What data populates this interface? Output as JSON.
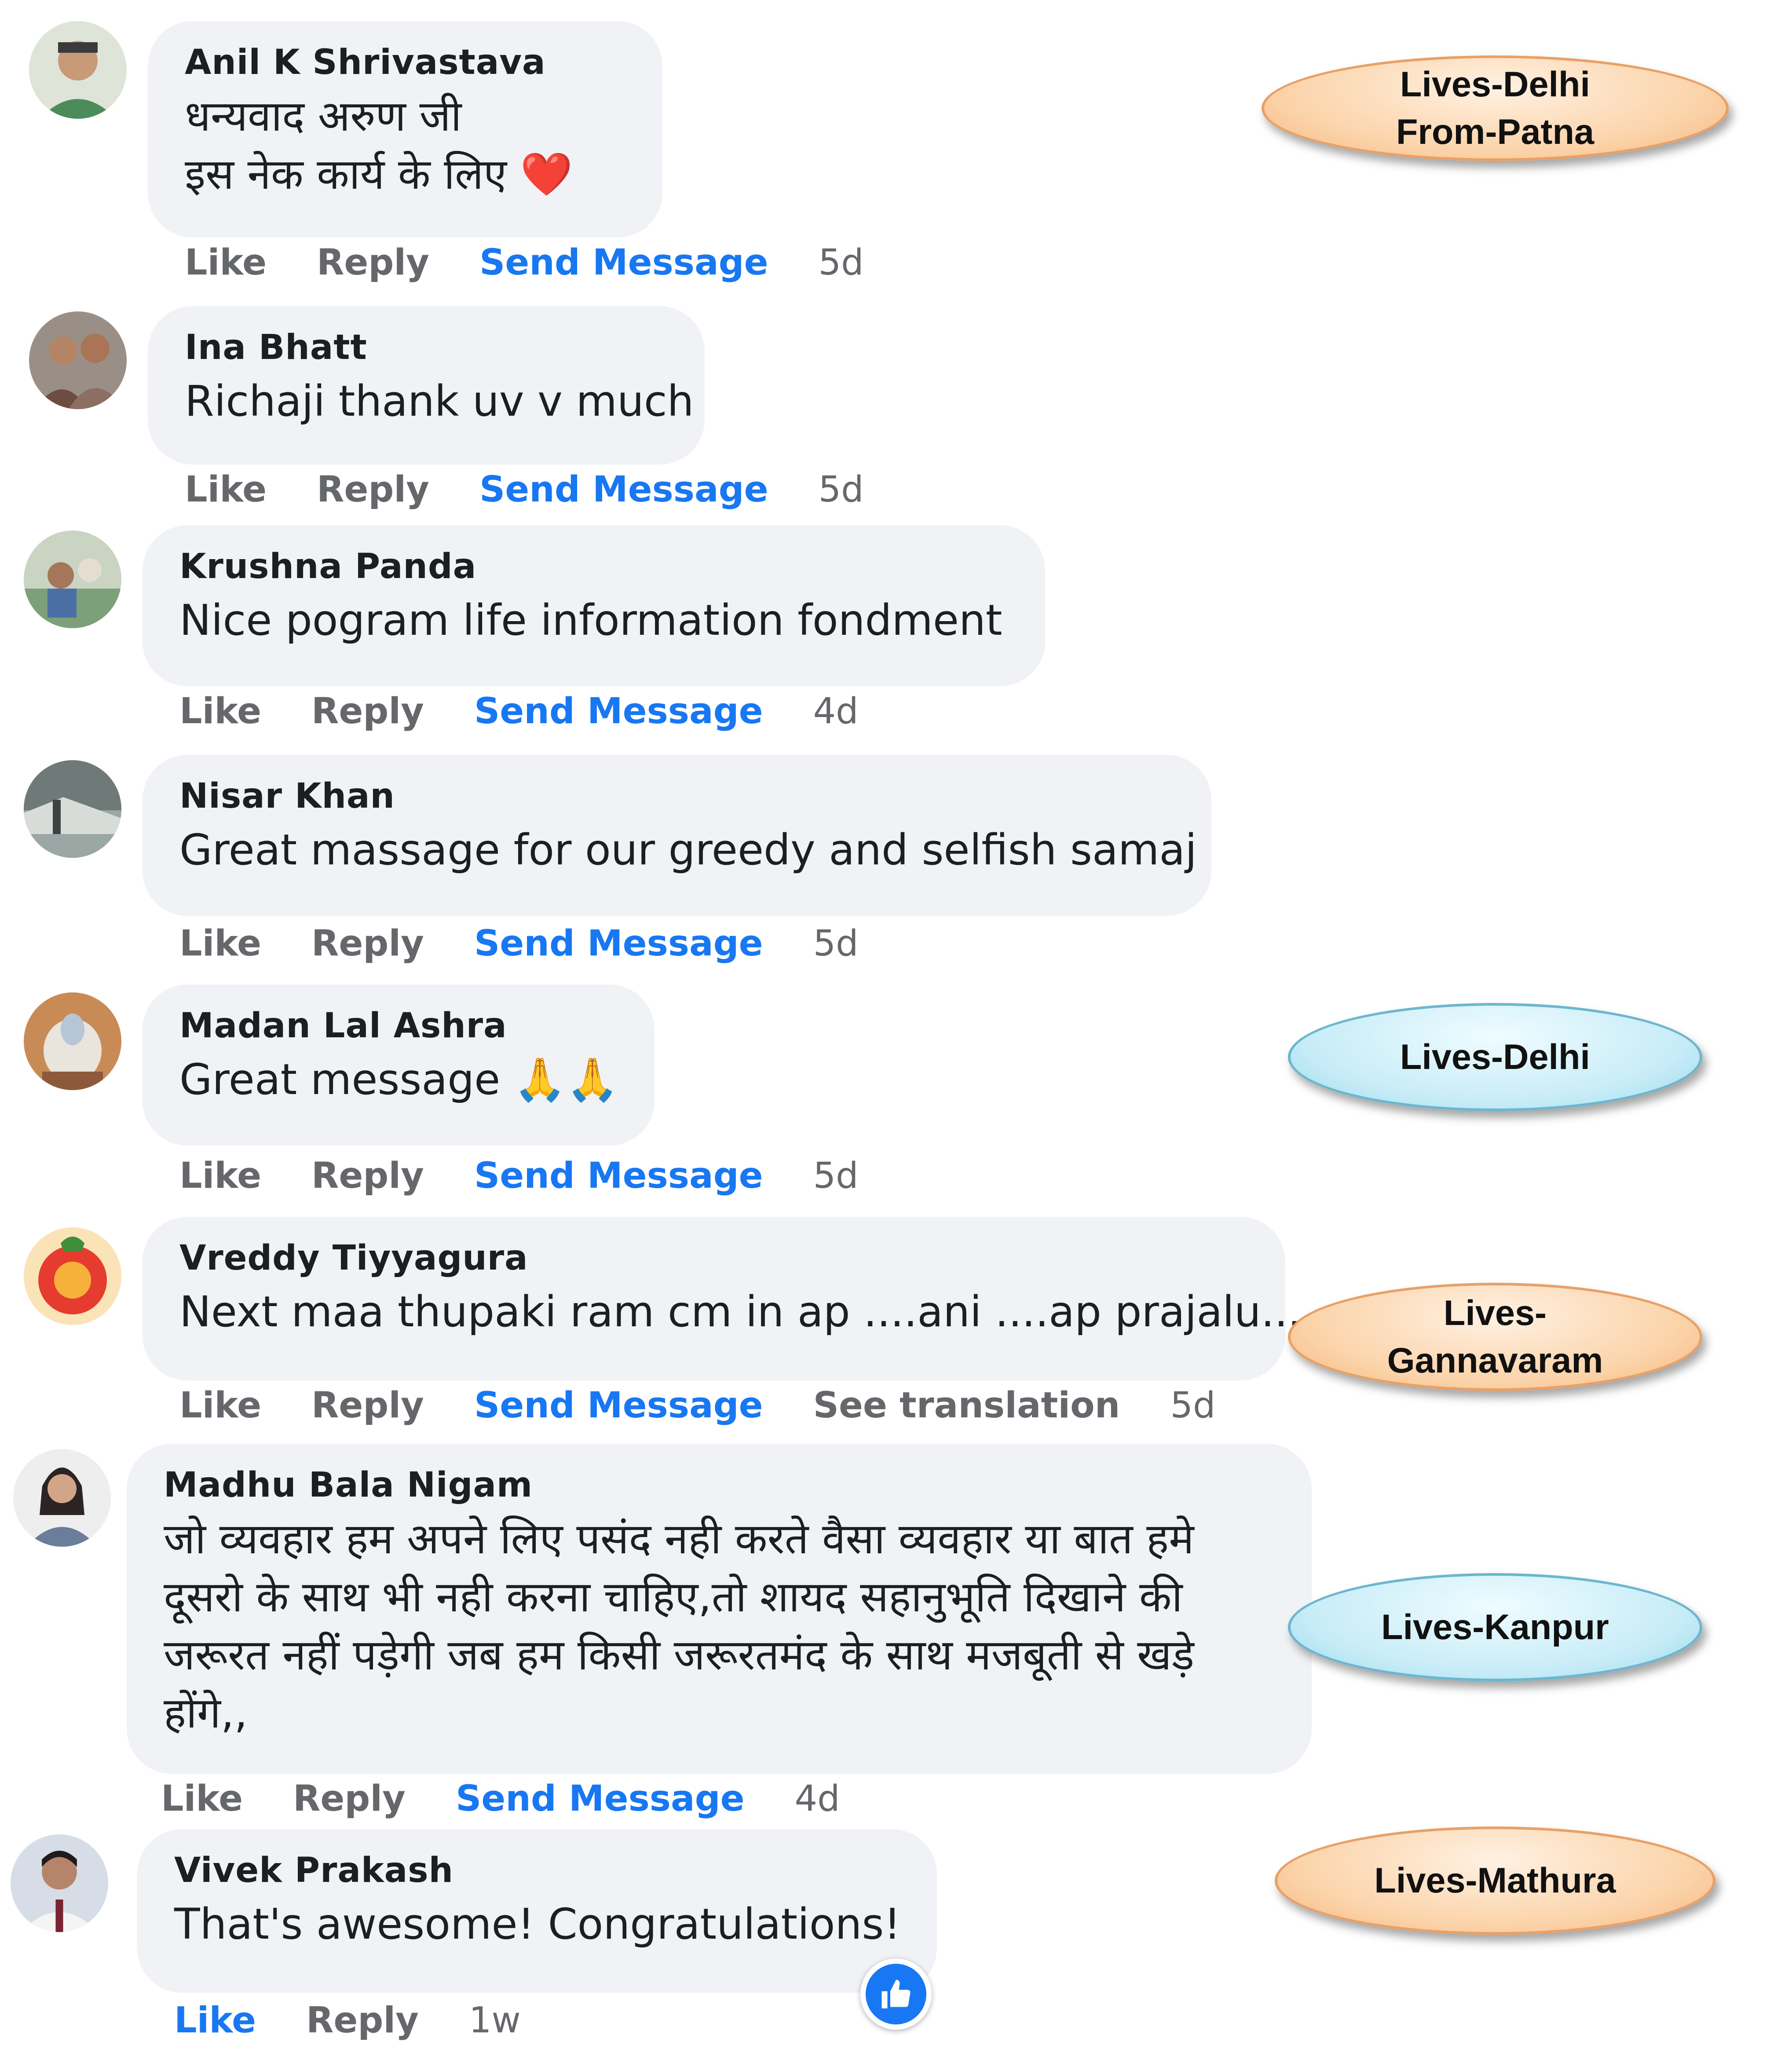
{
  "comments": [
    {
      "author": "Anil K Shrivastava",
      "lines": [
        "धन्यवाद अरुण जी",
        "इस नेक कार्य के लिए ❤️"
      ],
      "actions": {
        "like": "Like",
        "reply": "Reply",
        "message": "Send Message",
        "time": "5d"
      }
    },
    {
      "author": "Ina Bhatt",
      "lines": [
        "Richaji thank uv v much"
      ],
      "actions": {
        "like": "Like",
        "reply": "Reply",
        "message": "Send Message",
        "time": "5d"
      }
    },
    {
      "author": "Krushna Panda",
      "lines": [
        "Nice pogram life information fondment"
      ],
      "actions": {
        "like": "Like",
        "reply": "Reply",
        "message": "Send Message",
        "time": "4d"
      }
    },
    {
      "author": "Nisar Khan",
      "lines": [
        "Great massage for our greedy and selfish samaj"
      ],
      "actions": {
        "like": "Like",
        "reply": "Reply",
        "message": "Send Message",
        "time": "5d"
      }
    },
    {
      "author": "Madan Lal Ashra",
      "lines": [
        "Great message 🙏🙏"
      ],
      "actions": {
        "like": "Like",
        "reply": "Reply",
        "message": "Send Message",
        "time": "5d"
      }
    },
    {
      "author": "Vreddy Tiyyagura",
      "lines": [
        "Next maa thupaki ram cm in ap ....ani ....ap prajalu..."
      ],
      "actions": {
        "like": "Like",
        "reply": "Reply",
        "message": "Send Message",
        "translate": "See translation",
        "time": "5d"
      }
    },
    {
      "author": "Madhu Bala Nigam",
      "lines": [
        "जो व्यवहार हम अपने लिए पसंद नही करते वैसा व्यवहार या बात हमे दूसरो के साथ भी नही करना चाहिए,तो शायद सहानुभूति दिखाने की जरूरत नहीं पड़ेगी जब हम किसी जरूरतमंद के साथ मजबूती से खड़े होंगे,,"
      ],
      "actions": {
        "like": "Like",
        "reply": "Reply",
        "message": "Send Message",
        "time": "4d"
      }
    },
    {
      "author": "Vivek Prakash",
      "lines": [
        "That's awesome! Congratulations!"
      ],
      "actions": {
        "like": "Like",
        "reply": "Reply",
        "time": "1w"
      }
    }
  ],
  "annotations": [
    {
      "lines": [
        "Lives-Delhi",
        "From-Patna"
      ],
      "color": "#fbd3a9"
    },
    {
      "lines": [
        "Lives-Delhi"
      ],
      "color": "#c7ecf7"
    },
    {
      "lines": [
        "Lives-",
        "Gannavaram"
      ],
      "color": "#fbd3a9"
    },
    {
      "lines": [
        "Lives-Kanpur"
      ],
      "color": "#c7ecf7"
    },
    {
      "lines": [
        "Lives-Mathura"
      ],
      "color": "#fbd3a9"
    }
  ],
  "colors": {
    "link_blue": "#1877f2",
    "bubble_bg": "#f0f2f5",
    "muted": "#65676b"
  },
  "icons": {
    "reaction": "thumbs-up-icon",
    "heart": "red-heart-emoji",
    "pray": "folded-hands-emoji"
  }
}
